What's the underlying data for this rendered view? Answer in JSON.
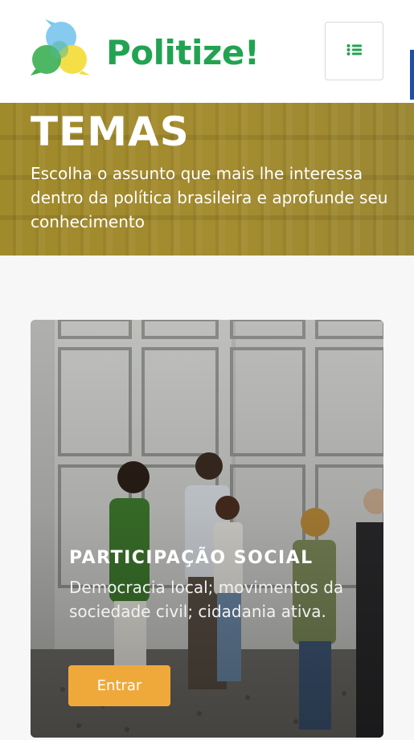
{
  "header": {
    "brand_name": "Politize!",
    "logo_icon": "speech-bubbles-logo",
    "menu_icon": "list-menu-icon",
    "colors": {
      "brand_green": "#22a352",
      "logo_blue": "#58b7e8",
      "logo_yellow": "#f4dd3f"
    }
  },
  "hero": {
    "title": "TEMAS",
    "subtitle": "Escolha o assunto que mais lhe interessa dentro da política brasileira e aprofunde seu conhecimento",
    "background_color": "#a48c30"
  },
  "topics": [
    {
      "title": "PARTICIPAÇÃO SOCIAL",
      "description": "Democracia local; movimentos da sociedade civil; cidadania ativa.",
      "button_label": "Entrar",
      "button_color": "#efa93b"
    }
  ]
}
